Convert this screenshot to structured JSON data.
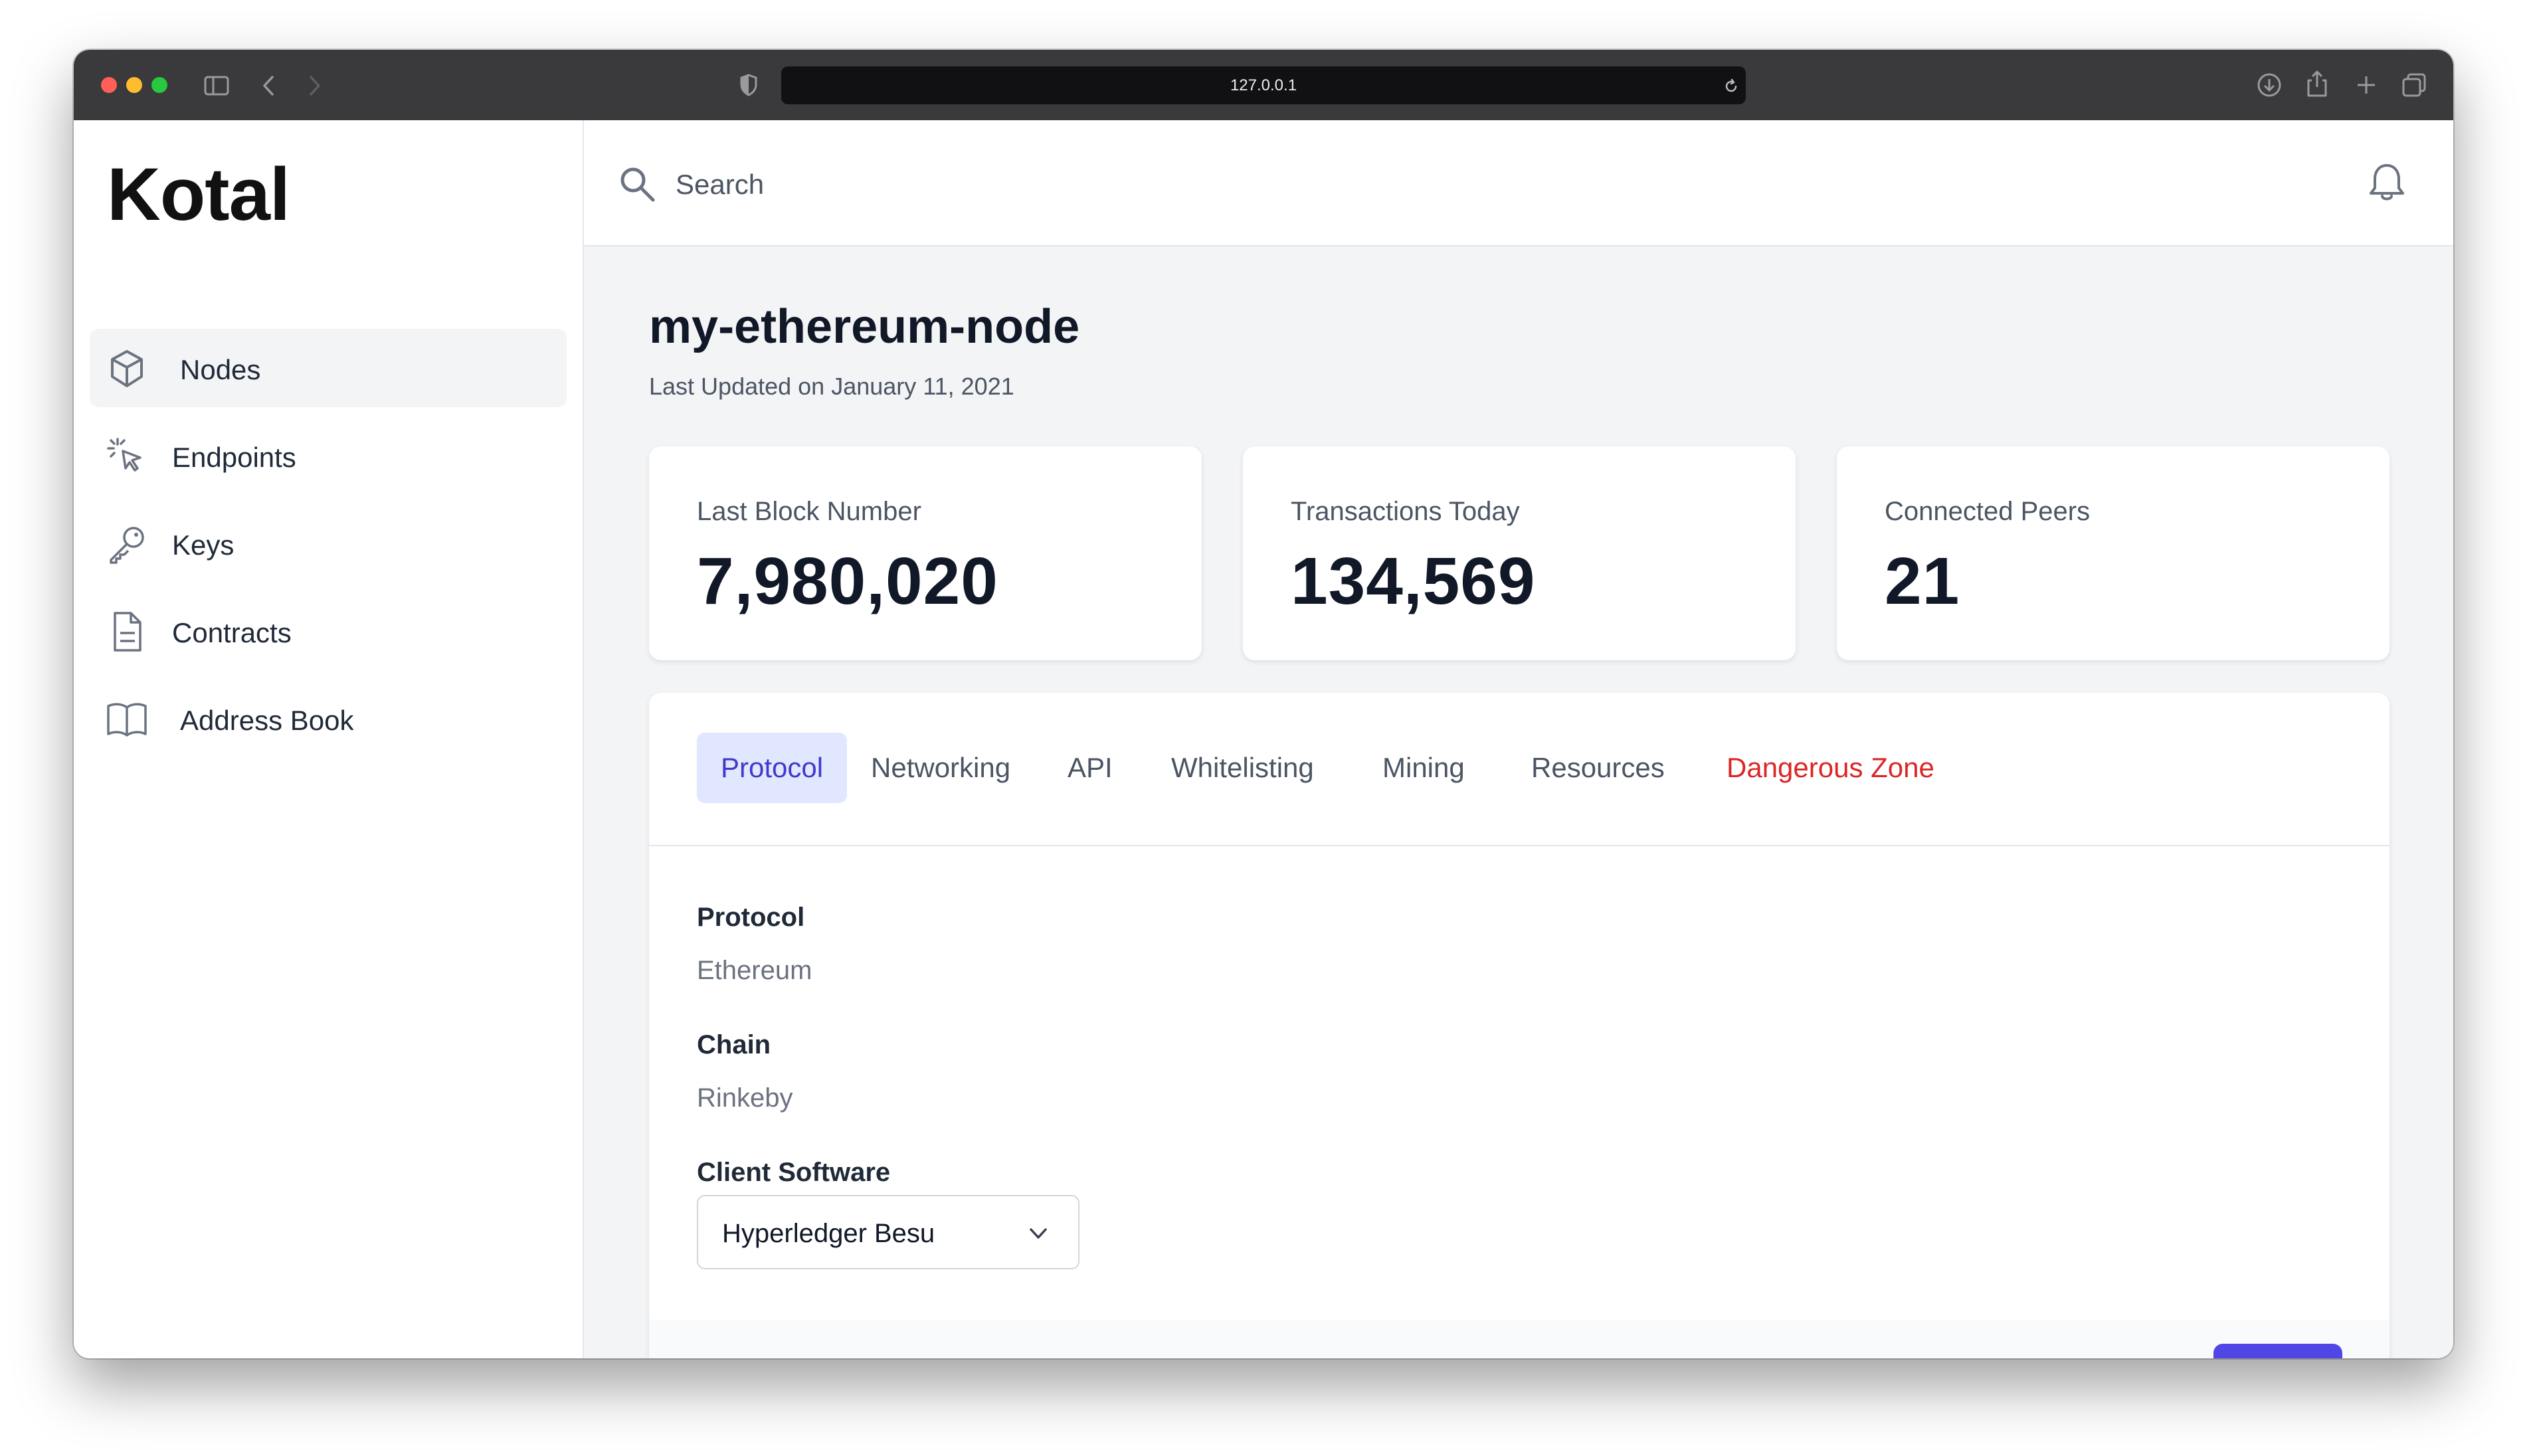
{
  "browser": {
    "url": "127.0.0.1"
  },
  "sidebar": {
    "logo": "Kotal",
    "items": [
      {
        "label": "Nodes",
        "icon": "cube-icon",
        "active": true
      },
      {
        "label": "Endpoints",
        "icon": "cursor-click-icon",
        "active": false
      },
      {
        "label": "Keys",
        "icon": "key-icon",
        "active": false
      },
      {
        "label": "Contracts",
        "icon": "document-icon",
        "active": false
      },
      {
        "label": "Address Book",
        "icon": "book-icon",
        "active": false
      }
    ]
  },
  "topbar": {
    "search_placeholder": "Search",
    "notification_icon": "bell-icon"
  },
  "page": {
    "title": "my-ethereum-node",
    "subtitle": "Last Updated on January 11, 2021"
  },
  "stats": [
    {
      "label": "Last Block Number",
      "value": "7,980,020"
    },
    {
      "label": "Transactions Today",
      "value": "134,569"
    },
    {
      "label": "Connected Peers",
      "value": "21"
    }
  ],
  "tabs": [
    {
      "label": "Protocol",
      "active": true
    },
    {
      "label": "Networking"
    },
    {
      "label": "API"
    },
    {
      "label": "Whitelisting"
    },
    {
      "label": "Mining"
    },
    {
      "label": "Resources"
    },
    {
      "label": "Dangerous Zone",
      "danger": true
    }
  ],
  "form": {
    "protocol_label": "Protocol",
    "protocol_value": "Ethereum",
    "chain_label": "Chain",
    "chain_value": "Rinkeby",
    "client_label": "Client Software",
    "client_value": "Hyperledger Besu"
  },
  "colors": {
    "accent": "#4f46e5",
    "accent_light": "#e0e7ff",
    "danger": "#dc2626"
  }
}
